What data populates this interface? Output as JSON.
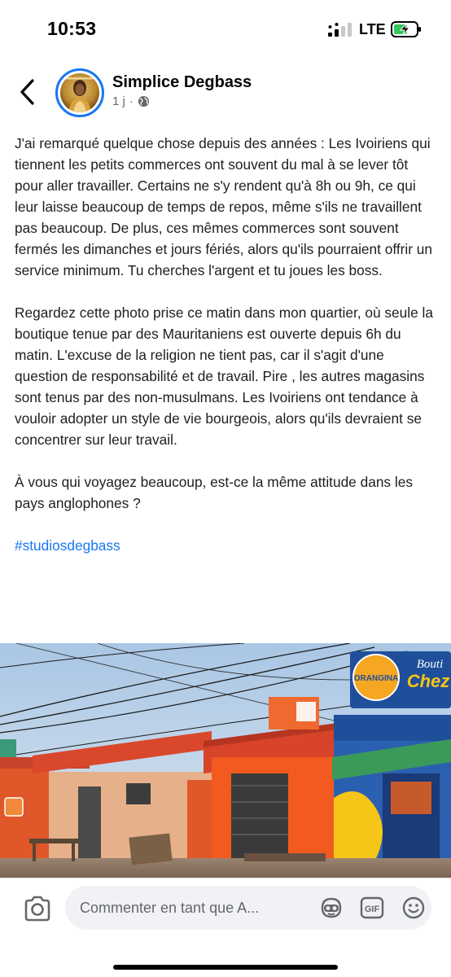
{
  "status_bar": {
    "time": "10:53",
    "network": "LTE"
  },
  "post": {
    "author": "Simplice Degbass",
    "timestamp": "1 j",
    "separator": "·",
    "paragraphs": [
      "J'ai remarqué quelque chose depuis des années : Les Ivoiriens qui tiennent les petits commerces ont souvent du mal à se lever tôt pour aller travailler. Certains ne s'y rendent qu'à 8h ou 9h, ce qui leur laisse beaucoup de temps de repos, même s'ils ne travaillent pas beaucoup. De plus, ces mêmes commerces sont souvent fermés les dimanches et jours fériés, alors qu'ils pourraient offrir un service minimum. Tu cherches l'argent et tu joues les boss.",
      "Regardez cette photo prise ce matin dans mon quartier, où seule la boutique tenue par des Mauritaniens est ouverte depuis 6h du matin. L'excuse de la religion ne tient pas, car il s'agit d'une question de responsabilité et de travail. Pire , les autres magasins sont tenus par des non-musulmans. Les Ivoiriens ont tendance à vouloir adopter un style de vie bourgeois, alors qu'ils devraient se concentrer sur leur travail.",
      "À vous qui voyagez beaucoup, est-ce la même attitude dans les pays anglophones ?"
    ],
    "hashtag": "#studiosdegbass",
    "photo_signs": {
      "orangina": "ORANGINA",
      "bouti": "Bouti",
      "chez": "Chez"
    }
  },
  "comment_bar": {
    "placeholder": "Commenter en tant que A...",
    "gif_label": "GIF"
  },
  "icons": {
    "back": "chevron-left-icon",
    "globe": "globe-icon",
    "camera": "camera-icon",
    "avatar_sticker": "avatar-sticker-icon",
    "gif": "gif-icon",
    "emoji": "emoji-icon"
  },
  "colors": {
    "brand": "#1877f2",
    "text": "#1c1e21",
    "meta": "#65676b",
    "input_bg": "#f0f2f5"
  }
}
